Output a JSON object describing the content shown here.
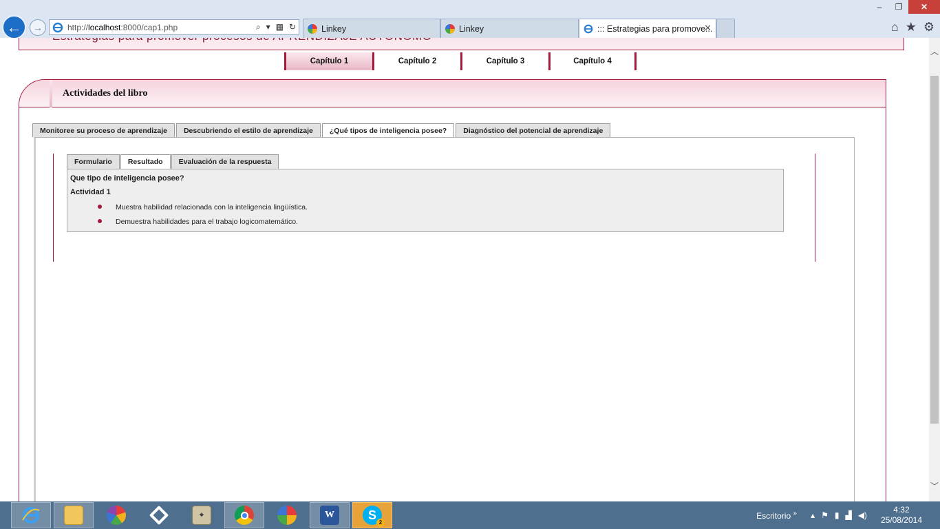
{
  "browser": {
    "address": {
      "prefix": "http://",
      "host": "localhost",
      "rest": ":8000/cap1.php"
    },
    "tabs": [
      {
        "label": "Linkey"
      },
      {
        "label": "Linkey"
      },
      {
        "label": "::: Estrategias para promove..."
      }
    ],
    "window_controls": {
      "minimize": "‒",
      "restore": "❐",
      "close": "✕"
    },
    "chrome_icons": {
      "home": "⌂",
      "favorites": "★",
      "settings": "⚙"
    }
  },
  "page": {
    "header_title": "Estrategias para promover procesos de  APRENDIZAJE AUTÓNOMO",
    "chapters": [
      {
        "label": "Capítulo 1"
      },
      {
        "label": "Capítulo 2"
      },
      {
        "label": "Capítulo 3"
      },
      {
        "label": "Capítulo 4"
      }
    ],
    "panel_title": "Actividades del libro",
    "outer_tabs": [
      {
        "label": "Monitoree su proceso de aprendizaje"
      },
      {
        "label": "Descubriendo el estilo de aprendizaje"
      },
      {
        "label": "¿Qué tipos de inteligencia posee?"
      },
      {
        "label": "Diagnóstico del potencial de aprendizaje"
      }
    ],
    "inner_tabs": [
      {
        "label": "Formulario"
      },
      {
        "label": "Resultado"
      },
      {
        "label": "Evaluación de la respuesta"
      }
    ],
    "result": {
      "question": "Que tipo de inteligencia posee?",
      "activity": "Actividad 1",
      "items": [
        "Muestra habilidad relacionada con la inteligencia lingüística.",
        "Demuestra habilidades para el trabajo logicomatemático."
      ]
    }
  },
  "taskbar": {
    "tray": {
      "desktop_label": "Escritorio",
      "chevron": "»",
      "time": "4:32",
      "date": "25/08/2014"
    },
    "skype_badge": "2"
  },
  "colors": {
    "accent": "#a31a3d",
    "taskbar": "#4f6f8e",
    "ie_blue": "#1c6ec6"
  }
}
